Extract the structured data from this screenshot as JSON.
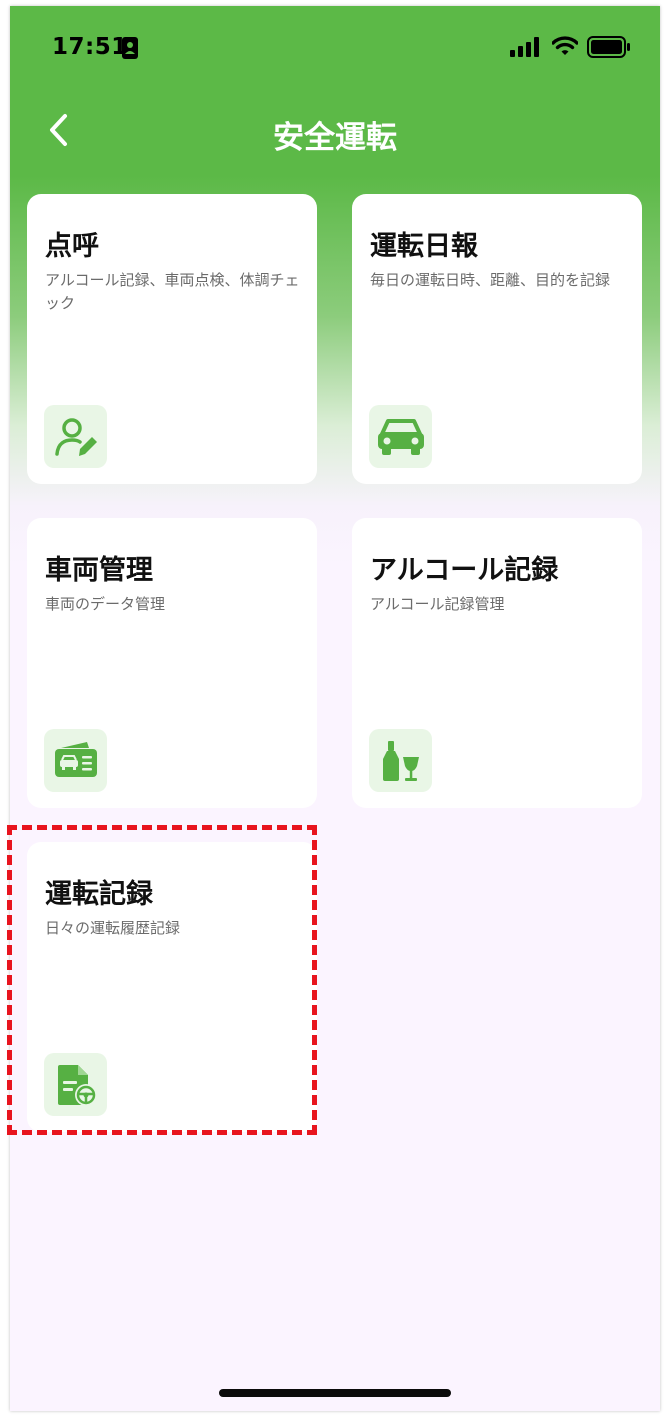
{
  "status_bar": {
    "time": "17:51"
  },
  "header": {
    "title": "安全運転",
    "back_icon": "chevron-left-icon"
  },
  "cards": [
    {
      "title": "点呼",
      "description": "アルコール記録、車両点検、体調チェック",
      "icon": "user-edit-icon"
    },
    {
      "title": "運転日報",
      "description": "毎日の運転日時、距離、目的を記録",
      "icon": "car-icon"
    },
    {
      "title": "車両管理",
      "description": "車両のデータ管理",
      "icon": "vehicle-card-icon"
    },
    {
      "title": "アルコール記録",
      "description": "アルコール記録管理",
      "icon": "bottle-glass-icon"
    },
    {
      "title": "運転記録",
      "description": "日々の運転履歴記録",
      "icon": "document-steering-icon"
    }
  ],
  "colors": {
    "brand_green": "#5cb947",
    "icon_green": "#56b043",
    "icon_bg": "#e9f6e6",
    "highlight_red": "#e8141e"
  }
}
